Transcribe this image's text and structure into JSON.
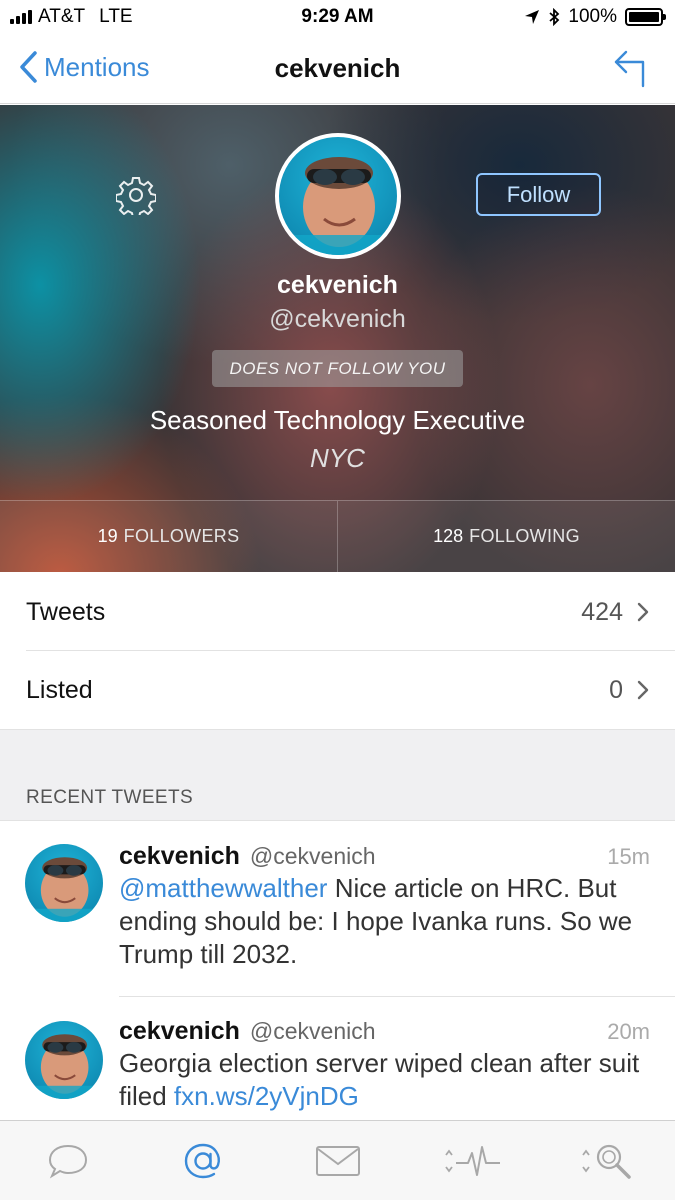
{
  "status_bar": {
    "carrier": "AT&T",
    "network": "LTE",
    "time": "9:29 AM",
    "battery": "100%",
    "battery_level": 1.0
  },
  "nav": {
    "back_label": "Mentions",
    "title": "cekvenich"
  },
  "profile": {
    "name": "cekvenich",
    "handle": "@cekvenich",
    "follow_label": "Follow",
    "relationship": "DOES NOT FOLLOW YOU",
    "bio": "Seasoned Technology Executive",
    "location": "NYC",
    "followers_count": "19",
    "followers_label": "FOLLOWERS",
    "following_count": "128",
    "following_label": "FOLLOWING"
  },
  "rows": [
    {
      "label": "Tweets",
      "value": "424"
    },
    {
      "label": "Listed",
      "value": "0"
    }
  ],
  "recent": {
    "section_title": "RECENT TWEETS",
    "tweets": [
      {
        "name": "cekvenich",
        "handle": "@cekvenich",
        "time": "15m",
        "link_prefix": "@matthewwalther",
        "text": " Nice article on HRC. But ending should be: I hope Ivanka runs. So we Trump till 2032."
      },
      {
        "name": "cekvenich",
        "handle": "@cekvenich",
        "time": "20m",
        "text": "Georgia election server wiped clean after suit filed ",
        "link_suffix": "fxn.ws/2yVjnDG"
      }
    ]
  },
  "tabs": [
    {
      "name": "timeline",
      "icon": "speech-bubble-icon"
    },
    {
      "name": "mentions",
      "icon": "at-sign-icon",
      "active": true
    },
    {
      "name": "messages",
      "icon": "envelope-icon"
    },
    {
      "name": "activity",
      "icon": "activity-icon"
    },
    {
      "name": "search",
      "icon": "search-icon"
    }
  ],
  "colors": {
    "accent": "#3a8ad8",
    "inactive_tab": "#a8a8a8"
  }
}
